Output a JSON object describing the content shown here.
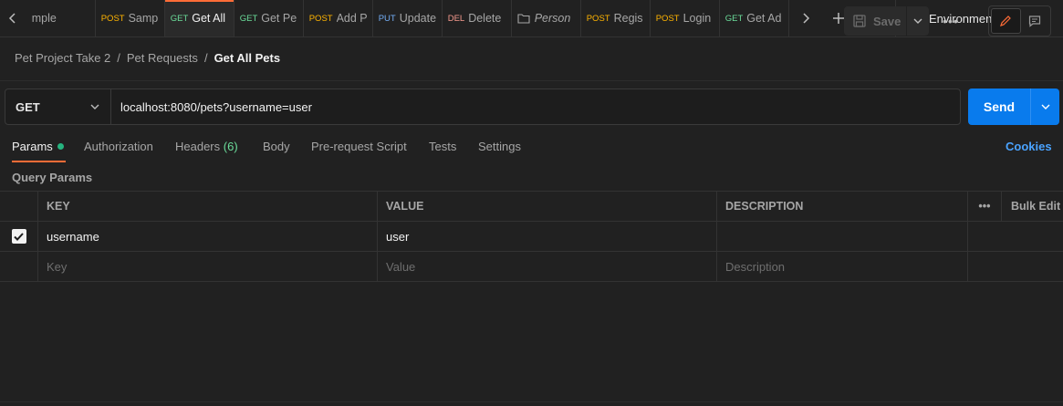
{
  "tabs": [
    {
      "method": "",
      "name": "mple",
      "active": false,
      "italic": false,
      "mclass": ""
    },
    {
      "method": "POST",
      "name": "Samp",
      "active": false,
      "italic": false,
      "mclass": "m-post"
    },
    {
      "method": "GET",
      "name": "Get All",
      "active": true,
      "italic": false,
      "mclass": "m-get"
    },
    {
      "method": "GET",
      "name": "Get Pe",
      "active": false,
      "italic": false,
      "mclass": "m-get"
    },
    {
      "method": "POST",
      "name": "Add P",
      "active": false,
      "italic": false,
      "mclass": "m-post"
    },
    {
      "method": "PUT",
      "name": "Update",
      "active": false,
      "italic": false,
      "mclass": "m-put"
    },
    {
      "method": "DEL",
      "name": "Delete",
      "active": false,
      "italic": false,
      "mclass": "m-del"
    },
    {
      "method": "folder-icon",
      "name": "Person",
      "active": false,
      "italic": true,
      "mclass": ""
    },
    {
      "method": "POST",
      "name": "Regis",
      "active": false,
      "italic": false,
      "mclass": "m-post"
    },
    {
      "method": "POST",
      "name": "Login",
      "active": false,
      "italic": false,
      "mclass": "m-post"
    },
    {
      "method": "GET",
      "name": "Get Ad",
      "active": false,
      "italic": false,
      "mclass": "m-get"
    }
  ],
  "environment": "No Environment",
  "breadcrumb": {
    "collection": "Pet Project Take 2",
    "folder": "Pet Requests",
    "current": "Get All Pets",
    "separator": "/"
  },
  "toolbar": {
    "save_label": "Save"
  },
  "request": {
    "method": "GET",
    "url": "localhost:8080/pets?username=user",
    "send_label": "Send"
  },
  "request_tabs": {
    "params": "Params",
    "authorization": "Authorization",
    "headers": "Headers",
    "headers_count": "(6)",
    "body": "Body",
    "prerequest": "Pre-request Script",
    "tests": "Tests",
    "settings": "Settings",
    "cookies": "Cookies"
  },
  "query_params": {
    "title": "Query Params",
    "headers": {
      "key": "KEY",
      "value": "VALUE",
      "description": "DESCRIPTION",
      "bulk_edit": "Bulk Edit"
    },
    "rows": [
      {
        "checked": true,
        "key": "username",
        "value": "user",
        "description": ""
      }
    ],
    "placeholders": {
      "key": "Key",
      "value": "Value",
      "description": "Description"
    }
  },
  "colors": {
    "accent": "#ff6c37",
    "send": "#097bed",
    "get": "#6bdd9a",
    "post": "#ffb400",
    "put": "#74aef6",
    "delete": "#f79a8e",
    "link": "#4aa3ff"
  }
}
